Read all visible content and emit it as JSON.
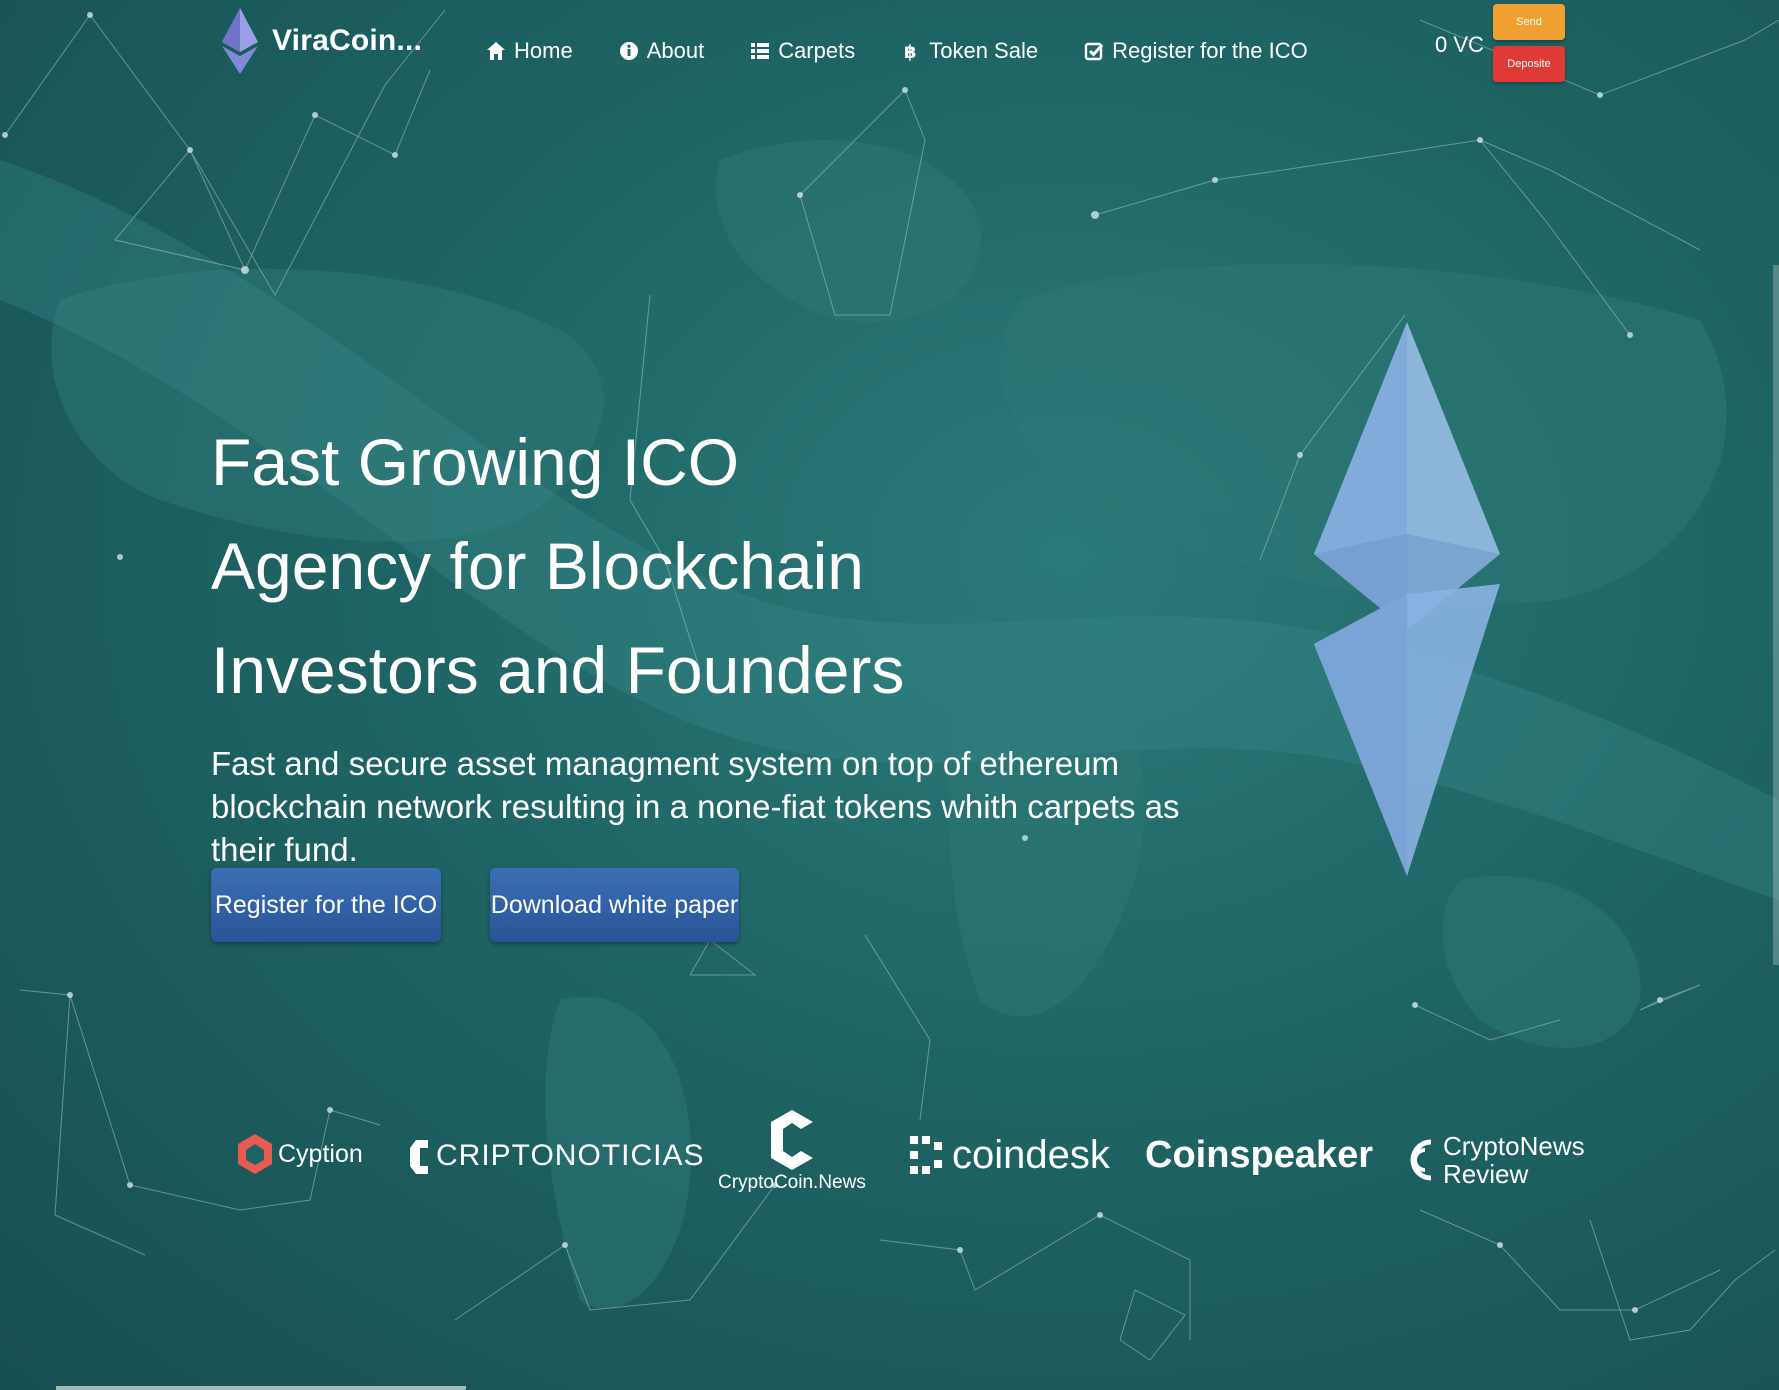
{
  "header": {
    "logo_text": "ViraCoin...",
    "nav": [
      {
        "label": "Home",
        "icon": "home-icon"
      },
      {
        "label": "About",
        "icon": "info-icon"
      },
      {
        "label": "Carpets",
        "icon": "list-icon"
      },
      {
        "label": "Token Sale",
        "icon": "bitcoin-icon"
      },
      {
        "label": "Register for the ICO",
        "icon": "check-square-icon"
      }
    ],
    "balance": "0 VC",
    "send_label": "Send",
    "deposit_label": "Deposite"
  },
  "hero": {
    "title_lines": [
      "Fast Growing ICO",
      "Agency for Blockchain",
      "Investors and Founders"
    ],
    "subtitle": "Fast and secure asset managment system on top of ethereum blockchain network resulting in a none-fiat tokens whith carpets as their fund.",
    "register_button": "Register for the ICO",
    "download_button": "Download white paper"
  },
  "partners": [
    {
      "name": "Cyption"
    },
    {
      "name": "CRIPTONOTICIAS"
    },
    {
      "name": "CryptoCoin.News"
    },
    {
      "name": "coindesk"
    },
    {
      "name": "Coinspeaker"
    },
    {
      "name_line1": "CryptoNews",
      "name_line2": "Review"
    }
  ],
  "colors": {
    "background": "#1f6464",
    "send_button": "#f0a030",
    "deposit_button": "#e03a36",
    "cta_button": "#2f5e9f",
    "eth_diamond": "#8fb8e6"
  }
}
